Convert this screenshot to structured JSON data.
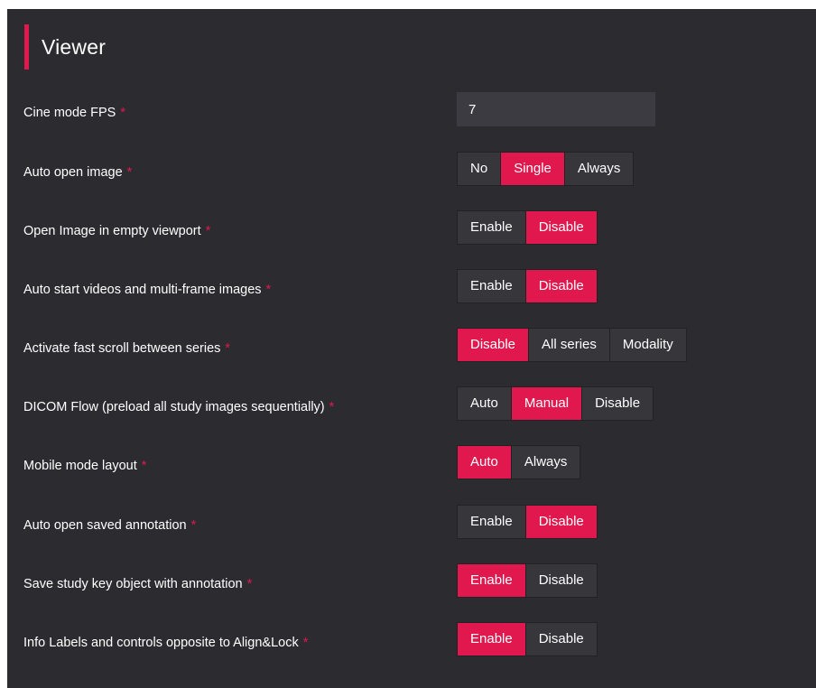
{
  "section": {
    "title": "Viewer"
  },
  "required_marker": "*",
  "settings": [
    {
      "label": "Cine mode FPS",
      "type": "input",
      "value": "7"
    },
    {
      "label": "Auto open image",
      "type": "segmented",
      "options": [
        "No",
        "Single",
        "Always"
      ],
      "selected": "Single"
    },
    {
      "label": "Open Image in empty viewport",
      "type": "segmented",
      "options": [
        "Enable",
        "Disable"
      ],
      "selected": "Disable"
    },
    {
      "label": "Auto start videos and multi-frame images",
      "type": "segmented",
      "options": [
        "Enable",
        "Disable"
      ],
      "selected": "Disable"
    },
    {
      "label": "Activate fast scroll between series",
      "type": "segmented",
      "options": [
        "Disable",
        "All series",
        "Modality"
      ],
      "selected": "Disable"
    },
    {
      "label": "DICOM Flow (preload all study images sequentially)",
      "type": "segmented",
      "options": [
        "Auto",
        "Manual",
        "Disable"
      ],
      "selected": "Manual"
    },
    {
      "label": "Mobile mode layout",
      "type": "segmented",
      "options": [
        "Auto",
        "Always"
      ],
      "selected": "Auto"
    },
    {
      "label": "Auto open saved annotation",
      "type": "segmented",
      "options": [
        "Enable",
        "Disable"
      ],
      "selected": "Disable"
    },
    {
      "label": "Save study key object with annotation",
      "type": "segmented",
      "options": [
        "Enable",
        "Disable"
      ],
      "selected": "Enable"
    },
    {
      "label": "Info Labels and controls opposite to Align&Lock",
      "type": "segmented",
      "options": [
        "Enable",
        "Disable"
      ],
      "selected": "Enable"
    }
  ],
  "colors": {
    "accent": "#e0184d",
    "panel_background": "#2c2c30",
    "button_background": "#36363b",
    "input_background": "#3b3b41",
    "text": "#ffffff"
  }
}
